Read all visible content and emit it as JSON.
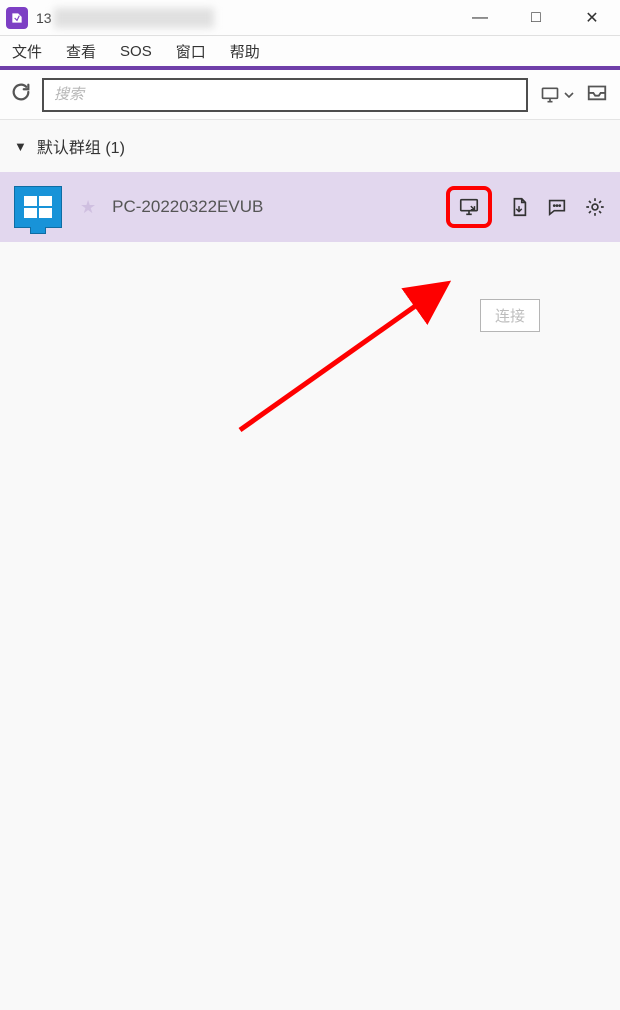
{
  "window": {
    "title": "13",
    "minimize": "—",
    "maximize": "□",
    "close": "✕"
  },
  "menu": {
    "file": "文件",
    "view": "查看",
    "sos": "SOS",
    "window": "窗口",
    "help": "帮助"
  },
  "toolbar": {
    "search_placeholder": "搜索"
  },
  "group": {
    "name": "默认群组",
    "count": "(1)"
  },
  "device": {
    "name": "PC-20220322EVUB",
    "actions": {
      "connect_icon": "monitor-arrow-icon",
      "file_icon": "file-transfer-icon",
      "chat_icon": "chat-icon",
      "settings_icon": "gear-icon"
    }
  },
  "tooltip_text": "连接",
  "colors": {
    "accent": "#6f3fa9",
    "row_bg": "#e2d7ee",
    "pc_blue": "#1893d8",
    "annotation_red": "#fe0000"
  }
}
